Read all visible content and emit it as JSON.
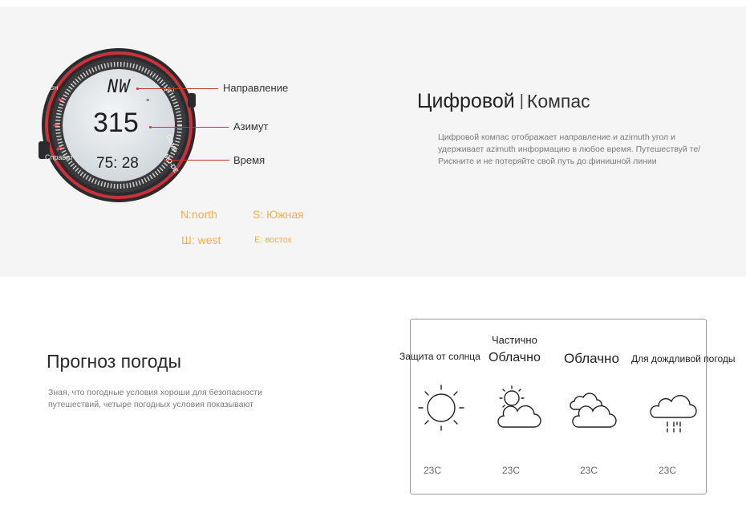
{
  "watch": {
    "direction": "NW",
    "azimuth": "315",
    "degree_symbol": "°",
    "time": "75: 28",
    "bezel_gh": "GH",
    "bezel_alt": "Ayt.i",
    "bezel_help": "Справит",
    "bezel_comp": "COMP",
    "bezel_mod": "MO-DE"
  },
  "callouts": {
    "direction": "Направление",
    "azimuth": "Азимут",
    "time": "Время"
  },
  "directions": {
    "north": "N:north",
    "south": "S: Южная",
    "west": "Ш: west",
    "east": "E: восток"
  },
  "compass": {
    "title_part1": "Цифровой",
    "separator": "|",
    "title_part2": "Компас",
    "description": "Цифровой компас отображает направление и azimuth угол и удерживает azimuth информацию в любое время. Путешествуй те/Рискните и не потеряйте свой путь до финишной линии"
  },
  "weather": {
    "title": "Прогноз погоды",
    "description": "Зная, что погодные условия хороши для безопасности путешествий, четыре погодных условия показывают",
    "conditions": [
      {
        "label": "Защита от солнца",
        "temp": "23C",
        "icon": "sun-icon"
      },
      {
        "label_line1": "Частично",
        "label_line2": "Облачно",
        "temp": "23C",
        "icon": "partly-cloudy-icon"
      },
      {
        "label": "Облачно",
        "temp": "23C",
        "icon": "cloudy-icon"
      },
      {
        "label": "Для дождливой погоды",
        "temp": "23C",
        "icon": "rain-icon"
      }
    ]
  },
  "colors": {
    "accent_red": "#c0392b",
    "direction_orange": "#f0b14a",
    "panel_bg": "#f6f5f5"
  }
}
